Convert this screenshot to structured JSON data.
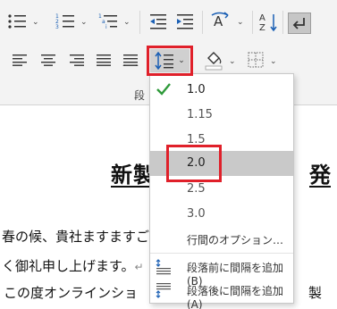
{
  "ribbon": {
    "group_label": "段",
    "buttons": [
      {
        "name": "bullets",
        "icon": "bullet-list-icon"
      },
      {
        "name": "numbering",
        "icon": "numbered-list-icon"
      },
      {
        "name": "multilevel-list",
        "icon": "multilevel-list-icon"
      },
      {
        "name": "decrease-indent",
        "icon": "decrease-indent-icon"
      },
      {
        "name": "increase-indent",
        "icon": "increase-indent-icon"
      },
      {
        "name": "text-direction",
        "icon": "text-direction-icon"
      },
      {
        "name": "sort",
        "icon": "sort-az-icon"
      },
      {
        "name": "show-marks",
        "icon": "paragraph-mark-icon"
      },
      {
        "name": "align-left",
        "icon": "align-left-icon"
      },
      {
        "name": "align-center",
        "icon": "align-center-icon"
      },
      {
        "name": "align-right",
        "icon": "align-right-icon"
      },
      {
        "name": "justify",
        "icon": "justify-icon"
      },
      {
        "name": "line-spacing",
        "icon": "line-spacing-icon"
      },
      {
        "name": "shading",
        "icon": "paint-bucket-icon"
      },
      {
        "name": "borders",
        "icon": "borders-icon"
      }
    ],
    "highlight_color": "#e0202a"
  },
  "menu": {
    "items": [
      {
        "label": "1.0",
        "checked": true
      },
      {
        "label": "1.15"
      },
      {
        "label": "1.5"
      },
      {
        "label": "2.0",
        "hovered": true
      },
      {
        "label": "2.5"
      },
      {
        "label": "3.0"
      }
    ],
    "options_label": "行間のオプション…",
    "add_before_label": "段落前に間隔を追加(B)",
    "add_after_label": "段落後に間隔を追加(A)"
  },
  "document": {
    "title": "新製",
    "title_end": "発",
    "line1": "春の候、貴社ますますご",
    "line2": "く御礼申し上げます。",
    "line2_mark": "↵",
    "line3": "この度オンラインショ",
    "line3_end": "製"
  }
}
